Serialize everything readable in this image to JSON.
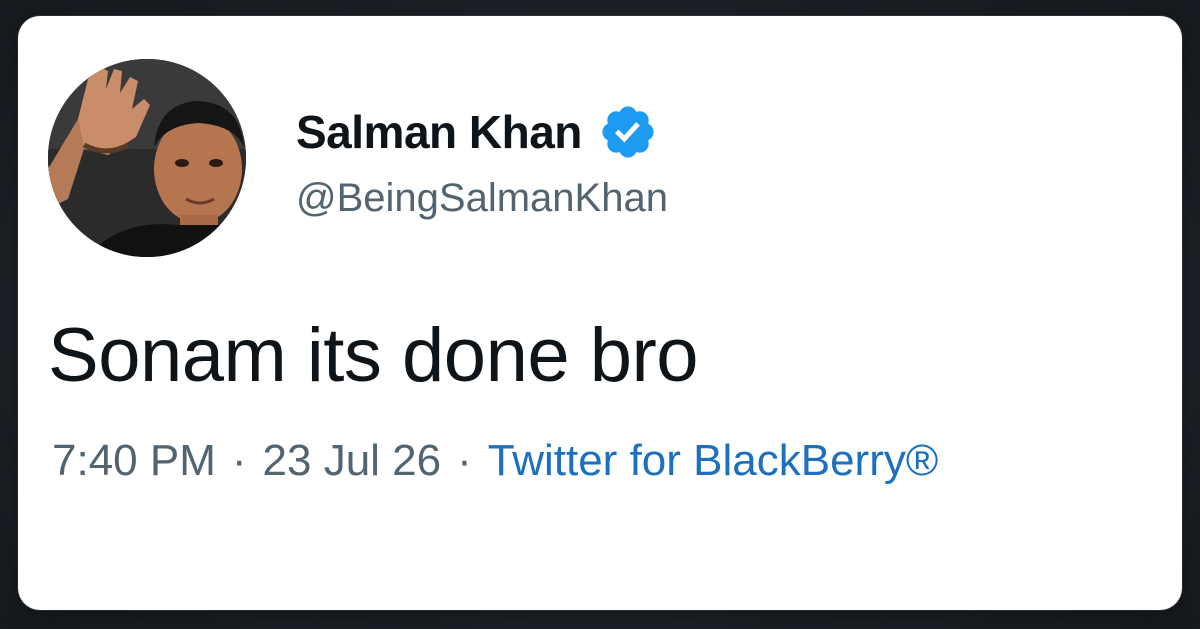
{
  "tweet": {
    "author": {
      "display_name": "Salman Khan",
      "handle": "@BeingSalmanKhan",
      "verified": true,
      "avatar": "profile-photo"
    },
    "text": "Sonam its done bro",
    "time": "7:40 PM",
    "separator": "·",
    "date": "23 Jul 26",
    "client": "Twitter for BlackBerry®"
  },
  "colors": {
    "name": "#0f1419",
    "secondary": "#536471",
    "link": "#1d6fbf",
    "verified_badge": "#1d9bf0",
    "card_background": "#ffffff",
    "page_background": "#1b1f25"
  },
  "icons": {
    "verified": "verified-badge-icon"
  }
}
